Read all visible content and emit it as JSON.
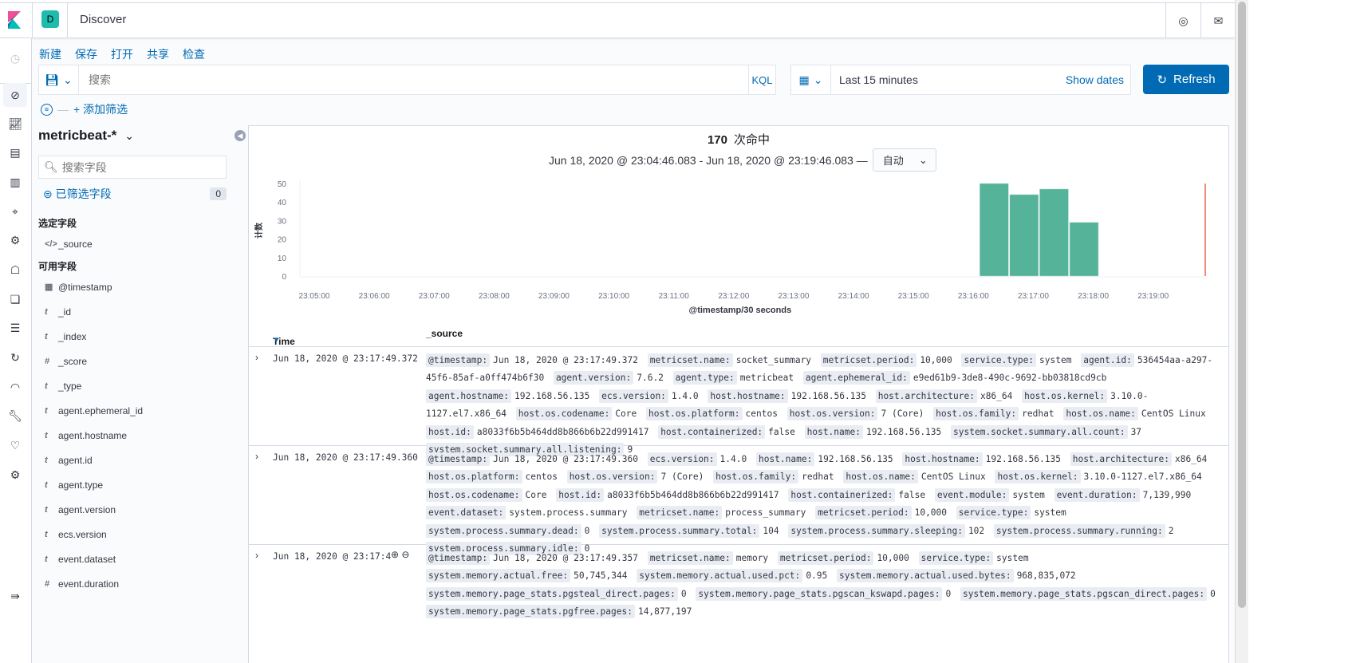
{
  "header": {
    "space_letter": "D",
    "title": "Discover"
  },
  "top_menu": [
    "新建",
    "保存",
    "打开",
    "共享",
    "检查"
  ],
  "search": {
    "placeholder": "搜索",
    "language": "KQL"
  },
  "date_picker": {
    "range": "Last 15 minutes",
    "show_dates": "Show dates"
  },
  "refresh_label": "Refresh",
  "filter": {
    "add_filter": "+ 添加筛选"
  },
  "sidebar": {
    "index_pattern": "metricbeat-*",
    "field_search_placeholder": "搜索字段",
    "filtered_fields_label": "已筛选字段",
    "filtered_fields_count": "0",
    "selected_fields_title": "选定字段",
    "selected_fields": [
      {
        "type": "</>",
        "name": "_source"
      }
    ],
    "available_fields_title": "可用字段",
    "available_fields": [
      {
        "type": "cal",
        "name": "@timestamp"
      },
      {
        "type": "t",
        "name": "_id"
      },
      {
        "type": "t",
        "name": "_index"
      },
      {
        "type": "#",
        "name": "_score"
      },
      {
        "type": "t",
        "name": "_type"
      },
      {
        "type": "t",
        "name": "agent.ephemeral_id"
      },
      {
        "type": "t",
        "name": "agent.hostname"
      },
      {
        "type": "t",
        "name": "agent.id"
      },
      {
        "type": "t",
        "name": "agent.type"
      },
      {
        "type": "t",
        "name": "agent.version"
      },
      {
        "type": "t",
        "name": "ecs.version"
      },
      {
        "type": "t",
        "name": "event.dataset"
      },
      {
        "type": "#",
        "name": "event.duration"
      }
    ]
  },
  "results": {
    "hits": "170",
    "hits_label": "次命中",
    "time_range": "Jun 18, 2020 @ 23:04:46.083 - Jun 18, 2020 @ 23:19:46.083 —",
    "interval": "自动"
  },
  "chart_data": {
    "type": "bar",
    "title": "",
    "xlabel": "@timestamp/30 seconds",
    "ylabel": "计数",
    "x_ticks": [
      "23:05:00",
      "23:06:00",
      "23:07:00",
      "23:08:00",
      "23:09:00",
      "23:10:00",
      "23:11:00",
      "23:12:00",
      "23:13:00",
      "23:14:00",
      "23:15:00",
      "23:16:00",
      "23:17:00",
      "23:18:00",
      "23:19:00"
    ],
    "y_ticks": [
      0,
      10,
      20,
      30,
      40,
      50
    ],
    "ylim": [
      0,
      50
    ],
    "x": [
      "23:16:00",
      "23:16:30",
      "23:17:00",
      "23:17:30"
    ],
    "values": [
      50,
      44,
      47,
      29
    ],
    "now_marker": "23:19:46",
    "bar_color": "#54b399",
    "marker_color": "#e7664c"
  },
  "table": {
    "headers": {
      "time": "Time",
      "source": "_source"
    },
    "rows": [
      {
        "time": "Jun 18, 2020 @ 23:17:49.372",
        "fields": [
          [
            "@timestamp:",
            "Jun 18, 2020 @ 23:17:49.372"
          ],
          [
            "metricset.name:",
            "socket_summary"
          ],
          [
            "metricset.period:",
            "10,000"
          ],
          [
            "service.type:",
            "system"
          ],
          [
            "agent.id:",
            "536454aa-a297-45f6-85af-a0ff474b6f30"
          ],
          [
            "agent.version:",
            "7.6.2"
          ],
          [
            "agent.type:",
            "metricbeat"
          ],
          [
            "agent.ephemeral_id:",
            "e9ed61b9-3de8-490c-9692-bb03818cd9cb"
          ],
          [
            "agent.hostname:",
            "192.168.56.135"
          ],
          [
            "ecs.version:",
            "1.4.0"
          ],
          [
            "host.hostname:",
            "192.168.56.135"
          ],
          [
            "host.architecture:",
            "x86_64"
          ],
          [
            "host.os.kernel:",
            "3.10.0-1127.el7.x86_64"
          ],
          [
            "host.os.codename:",
            "Core"
          ],
          [
            "host.os.platform:",
            "centos"
          ],
          [
            "host.os.version:",
            "7 (Core)"
          ],
          [
            "host.os.family:",
            "redhat"
          ],
          [
            "host.os.name:",
            "CentOS Linux"
          ],
          [
            "host.id:",
            "a8033f6b5b464dd8b866b6b22d991417"
          ],
          [
            "host.containerized:",
            "false"
          ],
          [
            "host.name:",
            "192.168.56.135"
          ],
          [
            "system.socket.summary.all.count:",
            "37"
          ],
          [
            "system.socket.summary.all.listening:",
            "9"
          ]
        ]
      },
      {
        "time": "Jun 18, 2020 @ 23:17:49.360",
        "fields": [
          [
            "@timestamp:",
            "Jun 18, 2020 @ 23:17:49.360"
          ],
          [
            "ecs.version:",
            "1.4.0"
          ],
          [
            "host.name:",
            "192.168.56.135"
          ],
          [
            "host.hostname:",
            "192.168.56.135"
          ],
          [
            "host.architecture:",
            "x86_64"
          ],
          [
            "host.os.platform:",
            "centos"
          ],
          [
            "host.os.version:",
            "7 (Core)"
          ],
          [
            "host.os.family:",
            "redhat"
          ],
          [
            "host.os.name:",
            "CentOS Linux"
          ],
          [
            "host.os.kernel:",
            "3.10.0-1127.el7.x86_64"
          ],
          [
            "host.os.codename:",
            "Core"
          ],
          [
            "host.id:",
            "a8033f6b5b464dd8b866b6b22d991417"
          ],
          [
            "host.containerized:",
            "false"
          ],
          [
            "event.module:",
            "system"
          ],
          [
            "event.duration:",
            "7,139,990"
          ],
          [
            "event.dataset:",
            "system.process.summary"
          ],
          [
            "metricset.name:",
            "process_summary"
          ],
          [
            "metricset.period:",
            "10,000"
          ],
          [
            "service.type:",
            "system"
          ],
          [
            "system.process.summary.dead:",
            "0"
          ],
          [
            "system.process.summary.total:",
            "104"
          ],
          [
            "system.process.summary.sleeping:",
            "102"
          ],
          [
            "system.process.summary.running:",
            "2"
          ],
          [
            "system.process.summary.idle:",
            "0"
          ]
        ]
      },
      {
        "time": "Jun 18, 2020 @ 23:17:4",
        "fields": [
          [
            "@timestamp:",
            "Jun 18, 2020 @ 23:17:49.357"
          ],
          [
            "metricset.name:",
            "memory"
          ],
          [
            "metricset.period:",
            "10,000"
          ],
          [
            "service.type:",
            "system"
          ],
          [
            "system.memory.actual.free:",
            "50,745,344"
          ],
          [
            "system.memory.actual.used.pct:",
            "0.95"
          ],
          [
            "system.memory.actual.used.bytes:",
            "968,835,072"
          ],
          [
            "system.memory.page_stats.pgsteal_direct.pages:",
            "0"
          ],
          [
            "system.memory.page_stats.pgscan_kswapd.pages:",
            "0"
          ],
          [
            "system.memory.page_stats.pgscan_direct.pages:",
            "0"
          ],
          [
            "system.memory.page_stats.pgfree.pages:",
            "14,877,197"
          ]
        ]
      }
    ]
  }
}
